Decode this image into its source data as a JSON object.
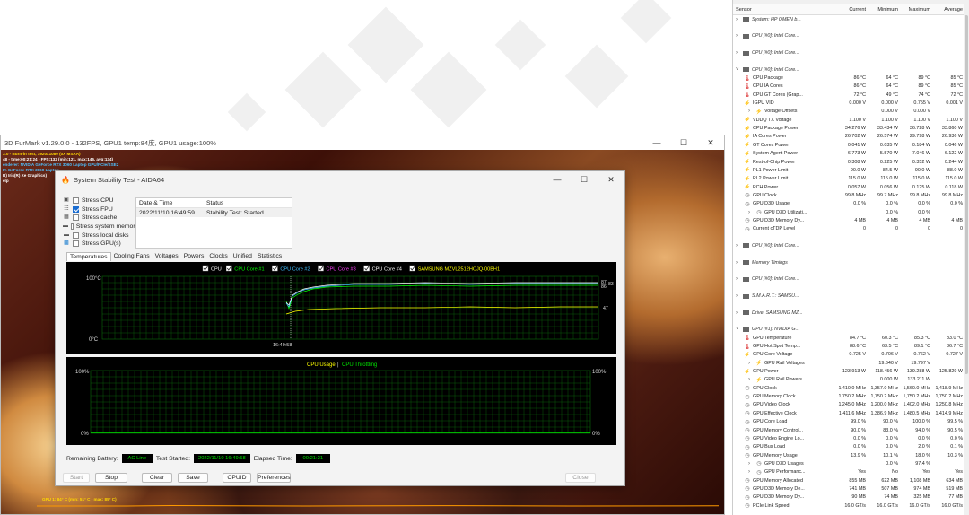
{
  "furmark": {
    "title": "3D FurMark v1.29.0.0 - 132FPS, GPU1 temp:84度, GPU1 usage:100%",
    "osd": [
      "3.0 - Burn-in test, 1920x1080 (0X MSAA)",
      "48 - time:00:21:24 - FPS:132 (min:121, max:146, avg:134)",
      "enderer: NVIDIA GeForce RTX 3060 Laptop GPU/PCIe/SSE2",
      "IA GeForce RTX 3060 Laptop",
      "R) Iris(R) Xe Graphics)",
      "elp"
    ],
    "gpu_line": "GPU 1: 84° C (min: 51° C - max: 85° C)"
  },
  "aida": {
    "title": "System Stability Test - AIDA64",
    "stress": [
      {
        "label": "Stress CPU",
        "checked": false,
        "icon": "cpu-icon"
      },
      {
        "label": "Stress FPU",
        "checked": true,
        "icon": "fpu-icon"
      },
      {
        "label": "Stress cache",
        "checked": false,
        "icon": "cache-icon"
      },
      {
        "label": "Stress system memory",
        "checked": false,
        "icon": "memory-icon"
      },
      {
        "label": "Stress local disks",
        "checked": false,
        "icon": "disk-icon"
      },
      {
        "label": "Stress GPU(s)",
        "checked": false,
        "icon": "gpu-icon"
      }
    ],
    "status_headers": [
      "Date & Time",
      "Status"
    ],
    "status_row": {
      "date": "2022/11/10 16:49:59",
      "status": "Stability Test: Started"
    },
    "tabs": [
      "Temperatures",
      "Cooling Fans",
      "Voltages",
      "Powers",
      "Clocks",
      "Unified",
      "Statistics"
    ],
    "temp_legend": [
      {
        "label": "CPU",
        "color": "#ffffff"
      },
      {
        "label": "CPU Core #1",
        "color": "#00ff00"
      },
      {
        "label": "CPU Core #2",
        "color": "#40c0ff"
      },
      {
        "label": "CPU Core #3",
        "color": "#ff40ff"
      },
      {
        "label": "CPU Core #4",
        "color": "#ffffff"
      },
      {
        "label": "SAMSUNG MZVL2512HCJQ-00BH1",
        "color": "#ffff00"
      }
    ],
    "temp_axis": {
      "top": "100°C",
      "bottom": "0°C",
      "time": "16:49:58"
    },
    "temp_right_values": [
      "87",
      "86",
      "83",
      "47"
    ],
    "usage_legend": {
      "a": "CPU Usage",
      "sep": "|",
      "b": "CPU Throttling"
    },
    "usage_axis": {
      "top_left": "100%",
      "bottom_left": "0%",
      "top_right": "100%",
      "bottom_right": "0%"
    },
    "footer": {
      "battery_label": "Remaining Battery:",
      "battery": "AC Line",
      "started_label": "Test Started:",
      "started": "2022/11/10 16:49:58",
      "elapsed_label": "Elapsed Time:",
      "elapsed": "00:21:21"
    },
    "buttons": {
      "start": "Start",
      "stop": "Stop",
      "clear": "Clear",
      "save": "Save",
      "cpuid": "CPUID",
      "prefs": "Preferences",
      "close": "Close"
    }
  },
  "hwinfo": {
    "headers": [
      "Sensor",
      "Current",
      "Minimum",
      "Maximum",
      "Average"
    ],
    "rows": [
      {
        "k": "grp",
        "n": "System: HP OMEN b..."
      },
      {
        "k": "sep"
      },
      {
        "k": "grp",
        "n": "CPU [#0]: Intel Core..."
      },
      {
        "k": "sep"
      },
      {
        "k": "grp",
        "n": "CPU [#0]: Intel Core..."
      },
      {
        "k": "sep"
      },
      {
        "k": "grp",
        "n": "CPU [#0]: Intel Core...",
        "open": true
      },
      {
        "k": "s",
        "i": "t",
        "n": "CPU Package",
        "v": [
          "86 °C",
          "64 °C",
          "89 °C",
          "85 °C"
        ]
      },
      {
        "k": "s",
        "i": "t",
        "n": "CPU IA Cores",
        "v": [
          "86 °C",
          "64 °C",
          "89 °C",
          "85 °C"
        ]
      },
      {
        "k": "s",
        "i": "t",
        "n": "CPU GT Cores (Grap...",
        "v": [
          "72 °C",
          "49 °C",
          "74 °C",
          "72 °C"
        ]
      },
      {
        "k": "s",
        "i": "v",
        "n": "IGPU VID",
        "v": [
          "0.000 V",
          "0.000 V",
          "0.755 V",
          "0.001 V"
        ]
      },
      {
        "k": "s",
        "i": "v",
        "n": "Voltage Offsets",
        "v": [
          "",
          "0.000 V",
          "0.000 V",
          ""
        ],
        "sub": true
      },
      {
        "k": "s",
        "i": "v",
        "n": "VDDQ TX Voltage",
        "v": [
          "1.100 V",
          "1.100 V",
          "1.100 V",
          "1.100 V"
        ]
      },
      {
        "k": "s",
        "i": "p",
        "n": "CPU Package Power",
        "v": [
          "34.276 W",
          "33.434 W",
          "36.728 W",
          "33.860 W"
        ]
      },
      {
        "k": "s",
        "i": "p",
        "n": "IA Cores Power",
        "v": [
          "26.702 W",
          "26.574 W",
          "29.798 W",
          "26.936 W"
        ]
      },
      {
        "k": "s",
        "i": "p",
        "n": "GT Cores Power",
        "v": [
          "0.041 W",
          "0.035 W",
          "0.184 W",
          "0.046 W"
        ]
      },
      {
        "k": "s",
        "i": "p",
        "n": "System Agent Power",
        "v": [
          "6.773 W",
          "5.570 W",
          "7.046 W",
          "6.122 W"
        ]
      },
      {
        "k": "s",
        "i": "p",
        "n": "Rest-of-Chip Power",
        "v": [
          "0.308 W",
          "0.225 W",
          "0.352 W",
          "0.244 W"
        ]
      },
      {
        "k": "s",
        "i": "p",
        "n": "PL1 Power Limit",
        "v": [
          "90.0 W",
          "84.5 W",
          "90.0 W",
          "88.0 W"
        ]
      },
      {
        "k": "s",
        "i": "p",
        "n": "PL2 Power Limit",
        "v": [
          "115.0 W",
          "115.0 W",
          "115.0 W",
          "115.0 W"
        ]
      },
      {
        "k": "s",
        "i": "p",
        "n": "PCH Power",
        "v": [
          "0.057 W",
          "0.056 W",
          "0.125 W",
          "0.118 W"
        ]
      },
      {
        "k": "s",
        "i": "c",
        "n": "GPU Clock",
        "v": [
          "99.8 MHz",
          "99.7 MHz",
          "99.8 MHz",
          "99.8 MHz"
        ]
      },
      {
        "k": "s",
        "i": "c",
        "n": "GPU D3D Usage",
        "v": [
          "0.0 %",
          "0.0 %",
          "0.0 %",
          "0.0 %"
        ]
      },
      {
        "k": "s",
        "i": "c",
        "n": "GPU D3D Utilizati...",
        "v": [
          "",
          "0.0 %",
          "0.0 %",
          ""
        ],
        "sub": true
      },
      {
        "k": "s",
        "i": "c",
        "n": "GPU D3D Memory Dy...",
        "v": [
          "4 MB",
          "4 MB",
          "4 MB",
          "4 MB"
        ]
      },
      {
        "k": "s",
        "i": "c",
        "n": "Current cTDP Level",
        "v": [
          "0",
          "0",
          "0",
          "0"
        ]
      },
      {
        "k": "sep"
      },
      {
        "k": "grp",
        "n": "CPU [#0]: Intel Core..."
      },
      {
        "k": "sep"
      },
      {
        "k": "grp",
        "n": "Memory Timings"
      },
      {
        "k": "sep"
      },
      {
        "k": "grp",
        "n": "CPU [#0]: Intel Core..."
      },
      {
        "k": "sep"
      },
      {
        "k": "grp",
        "n": "S.M.A.R.T.: SAMSU..."
      },
      {
        "k": "sep"
      },
      {
        "k": "grp",
        "n": "Drive: SAMSUNG MZ..."
      },
      {
        "k": "sep"
      },
      {
        "k": "grp",
        "n": "GPU [#1]: NVIDIA G...",
        "open": true
      },
      {
        "k": "s",
        "i": "t",
        "n": "GPU Temperature",
        "v": [
          "84.7 °C",
          "60.3 °C",
          "85.3 °C",
          "83.0 °C"
        ]
      },
      {
        "k": "s",
        "i": "t",
        "n": "GPU Hot Spot Temp...",
        "v": [
          "88.6 °C",
          "63.5 °C",
          "89.1 °C",
          "86.7 °C"
        ]
      },
      {
        "k": "s",
        "i": "v",
        "n": "GPU Core Voltage",
        "v": [
          "0.725 V",
          "0.706 V",
          "0.762 V",
          "0.727 V"
        ]
      },
      {
        "k": "s",
        "i": "v",
        "n": "GPU Rail Voltages",
        "v": [
          "",
          "19.640 V",
          "19.797 V",
          ""
        ],
        "sub": true
      },
      {
        "k": "s",
        "i": "p",
        "n": "GPU Power",
        "v": [
          "123.913 W",
          "118.456 W",
          "139.288 W",
          "125.829 W"
        ]
      },
      {
        "k": "s",
        "i": "p",
        "n": "GPU Rail Powers",
        "v": [
          "",
          "0.000 W",
          "133.211 W",
          ""
        ],
        "sub": true
      },
      {
        "k": "s",
        "i": "c",
        "n": "GPU Clock",
        "v": [
          "1,410.0 MHz",
          "1,357.0 MHz",
          "1,560.0 MHz",
          "1,418.9 MHz"
        ]
      },
      {
        "k": "s",
        "i": "c",
        "n": "GPU Memory Clock",
        "v": [
          "1,750.2 MHz",
          "1,750.2 MHz",
          "1,750.2 MHz",
          "1,750.2 MHz"
        ]
      },
      {
        "k": "s",
        "i": "c",
        "n": "GPU Video Clock",
        "v": [
          "1,245.0 MHz",
          "1,200.0 MHz",
          "1,402.0 MHz",
          "1,250.8 MHz"
        ]
      },
      {
        "k": "s",
        "i": "c",
        "n": "GPU Effective Clock",
        "v": [
          "1,411.6 MHz",
          "1,386.9 MHz",
          "1,480.5 MHz",
          "1,414.9 MHz"
        ]
      },
      {
        "k": "s",
        "i": "c",
        "n": "GPU Core Load",
        "v": [
          "99.0 %",
          "90.0 %",
          "100.0 %",
          "99.5 %"
        ]
      },
      {
        "k": "s",
        "i": "c",
        "n": "GPU Memory Control...",
        "v": [
          "90.0 %",
          "83.0 %",
          "94.0 %",
          "90.5 %"
        ]
      },
      {
        "k": "s",
        "i": "c",
        "n": "GPU Video Engine Lo...",
        "v": [
          "0.0 %",
          "0.0 %",
          "0.0 %",
          "0.0 %"
        ]
      },
      {
        "k": "s",
        "i": "c",
        "n": "GPU Bus Load",
        "v": [
          "0.0 %",
          "0.0 %",
          "2.0 %",
          "0.1 %"
        ]
      },
      {
        "k": "s",
        "i": "c",
        "n": "GPU Memory Usage",
        "v": [
          "13.9 %",
          "10.1 %",
          "18.0 %",
          "10.3 %"
        ]
      },
      {
        "k": "s",
        "i": "c",
        "n": "GPU D3D Usages",
        "v": [
          "",
          "0.0 %",
          "97.4 %",
          ""
        ],
        "sub": true
      },
      {
        "k": "s",
        "i": "c",
        "n": "GPU Performanc...",
        "v": [
          "Yes",
          "No",
          "Yes",
          "Yes"
        ],
        "sub": true
      },
      {
        "k": "s",
        "i": "c",
        "n": "GPU Memory Allocated",
        "v": [
          "855 MB",
          "622 MB",
          "1,108 MB",
          "634 MB"
        ]
      },
      {
        "k": "s",
        "i": "c",
        "n": "GPU D3D Memory De...",
        "v": [
          "741 MB",
          "507 MB",
          "974 MB",
          "519 MB"
        ]
      },
      {
        "k": "s",
        "i": "c",
        "n": "GPU D3D Memory Dy...",
        "v": [
          "90 MB",
          "74 MB",
          "325 MB",
          "77 MB"
        ]
      },
      {
        "k": "s",
        "i": "c",
        "n": "PCIe Link Speed",
        "v": [
          "16.0 GT/s",
          "16.0 GT/s",
          "16.0 GT/s",
          "16.0 GT/s"
        ]
      }
    ]
  }
}
